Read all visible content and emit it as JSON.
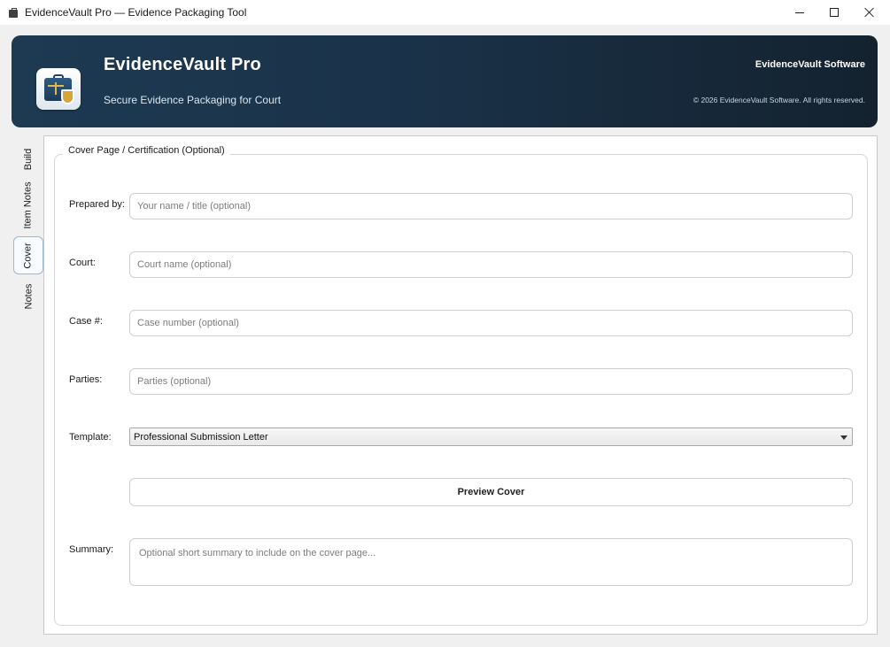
{
  "window": {
    "title": "EvidenceVault Pro — Evidence Packaging Tool",
    "icon": "briefcase-icon"
  },
  "banner": {
    "app_name": "EvidenceVault Pro",
    "tagline": "Secure Evidence Packaging for Court",
    "company": "EvidenceVault Software",
    "copyright": "© 2026 EvidenceVault Software. All rights reserved.",
    "logo_icon": "briefcase-scales-shield-icon"
  },
  "tabs": [
    {
      "label": "Build",
      "active": false
    },
    {
      "label": "Item Notes",
      "active": false
    },
    {
      "label": "Cover",
      "active": true
    },
    {
      "label": "Notes",
      "active": false
    }
  ],
  "cover": {
    "group_title": "Cover Page / Certification (Optional)",
    "prepared_by": {
      "label": "Prepared by:",
      "value": "",
      "placeholder": "Your name / title (optional)"
    },
    "court": {
      "label": "Court:",
      "value": "",
      "placeholder": "Court name (optional)"
    },
    "case_number": {
      "label": "Case #:",
      "value": "",
      "placeholder": "Case number (optional)"
    },
    "parties": {
      "label": "Parties:",
      "value": "",
      "placeholder": "Parties (optional)"
    },
    "template": {
      "label": "Template:",
      "selected": "Professional Submission Letter"
    },
    "preview_button": "Preview Cover",
    "summary": {
      "label": "Summary:",
      "value": "",
      "placeholder": "Optional short summary to include on the cover page..."
    }
  },
  "colors": {
    "banner_start": "#1d3a52",
    "banner_end": "#14222f",
    "active_tab_border": "#9cb7d6",
    "logo_accent": "#d6a53a"
  }
}
